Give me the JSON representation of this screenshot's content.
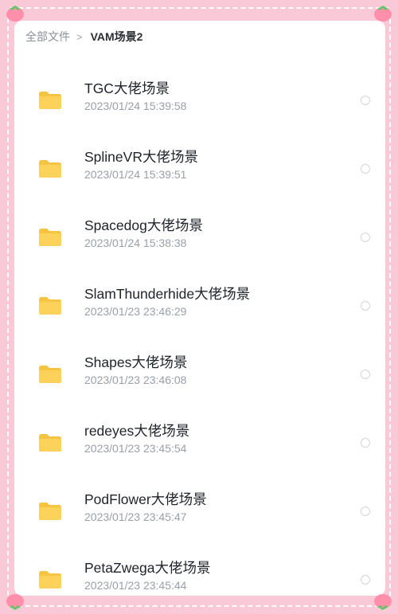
{
  "breadcrumb": {
    "root": "全部文件",
    "separator": ">",
    "current": "VAM场景2"
  },
  "theme": {
    "frame_bg": "#f9c9d8",
    "folder_color": "#fcd25a",
    "folder_tab_color": "#f6c443"
  },
  "files": [
    {
      "name": "TGC大佬场景",
      "time": "2023/01/24 15:39:58",
      "icon": "folder-icon"
    },
    {
      "name": "SplineVR大佬场景",
      "time": "2023/01/24 15:39:51",
      "icon": "folder-icon"
    },
    {
      "name": "Spacedog大佬场景",
      "time": "2023/01/24 15:38:38",
      "icon": "folder-icon"
    },
    {
      "name": "SlamThunderhide大佬场景",
      "time": "2023/01/23 23:46:29",
      "icon": "folder-icon"
    },
    {
      "name": "Shapes大佬场景",
      "time": "2023/01/23 23:46:08",
      "icon": "folder-icon"
    },
    {
      "name": "redeyes大佬场景",
      "time": "2023/01/23 23:45:54",
      "icon": "folder-icon"
    },
    {
      "name": "PodFlower大佬场景",
      "time": "2023/01/23 23:45:47",
      "icon": "folder-icon"
    },
    {
      "name": "PetaZwega大佬场景",
      "time": "2023/01/23 23:45:44",
      "icon": "folder-icon"
    }
  ]
}
